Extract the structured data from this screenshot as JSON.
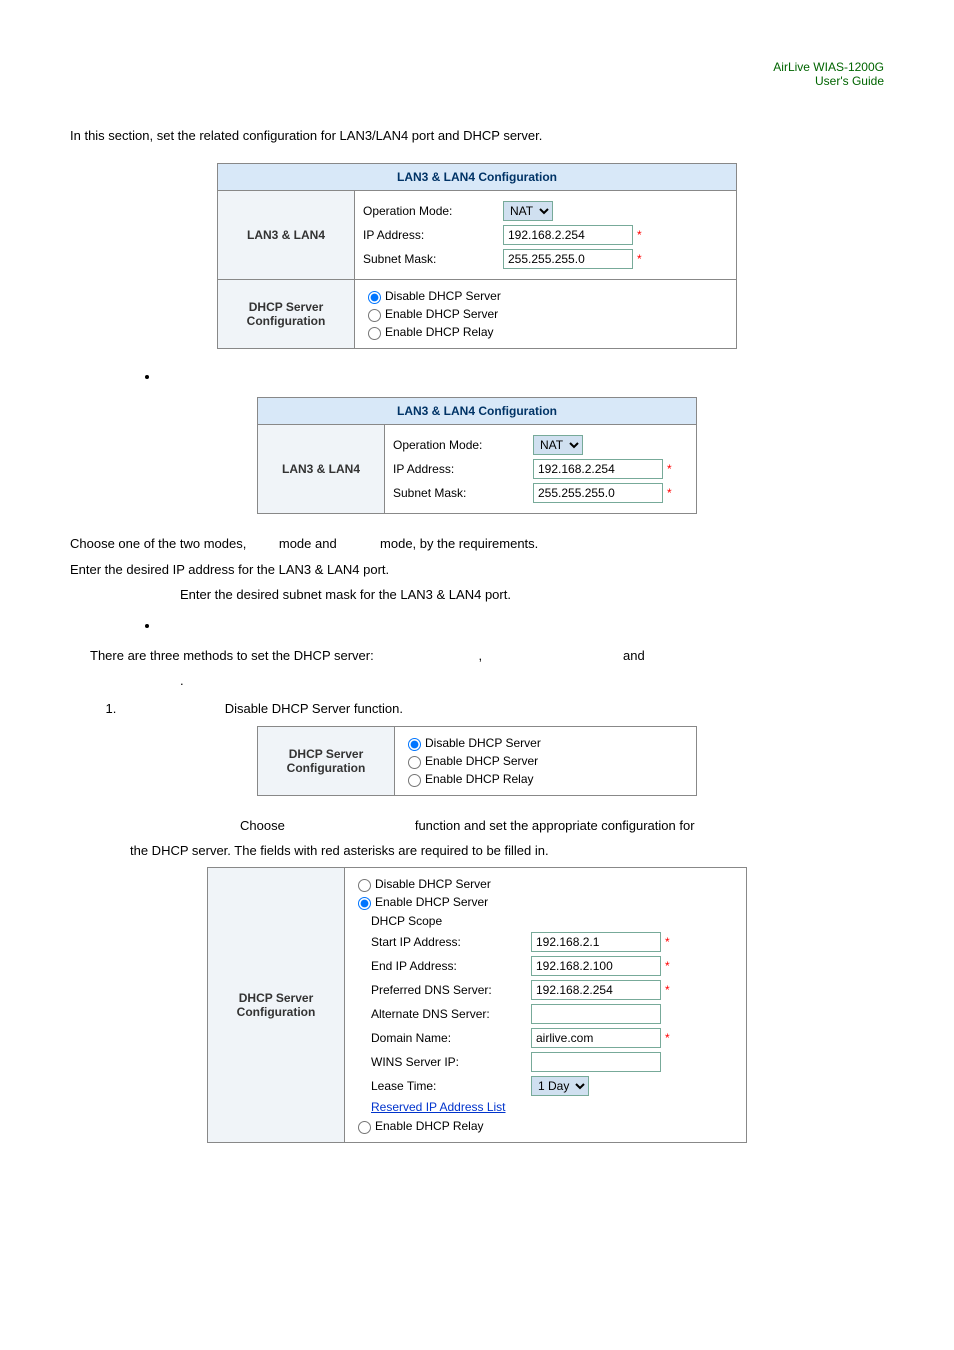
{
  "header": {
    "product": "AirLive  WIAS-1200G",
    "subtitle": "User's  Guide"
  },
  "intro": "In this section, set the related configuration for LAN3/LAN4 port and DHCP server.",
  "table1": {
    "title": "LAN3 & LAN4 Configuration",
    "row1_label": "LAN3 & LAN4",
    "op_mode_label": "Operation Mode:",
    "op_mode_value": "NAT",
    "ip_label": "IP Address:",
    "ip_value": "192.168.2.254",
    "subnet_label": "Subnet Mask:",
    "subnet_value": "255.255.255.0",
    "row2_label": "DHCP Server Configuration",
    "radio1": "Disable DHCP Server",
    "radio2": "Enable DHCP Server",
    "radio3": "Enable DHCP Relay"
  },
  "table2": {
    "title": "LAN3 & LAN4 Configuration",
    "row1_label": "LAN3 & LAN4",
    "op_mode_label": "Operation Mode:",
    "op_mode_value": "NAT",
    "ip_label": "IP Address:",
    "ip_value": "192.168.2.254",
    "subnet_label": "Subnet Mask:",
    "subnet_value": "255.255.255.0"
  },
  "explain": {
    "modes_pre": "Choose one of the two modes,",
    "modes_mid": "mode and",
    "modes_post": "mode, by the requirements.",
    "ip_desc": "Enter the desired IP address for the LAN3 & LAN4 port.",
    "subnet_desc": "Enter the desired subnet mask for the LAN3 & LAN4 port."
  },
  "dhcp_intro": {
    "line1a": "There are three methods to set the DHCP server:",
    "line1b": ",",
    "line1c": "and",
    "line1d": "."
  },
  "item1": {
    "text": "Disable DHCP Server function."
  },
  "table3": {
    "row_label": "DHCP Server Configuration",
    "radio1": "Disable DHCP Server",
    "radio2": "Enable DHCP Server",
    "radio3": "Enable DHCP Relay"
  },
  "item2": {
    "pre": "Choose",
    "post": "function and set the appropriate configuration for",
    "line2": "the DHCP server. The fields with red asterisks are required to be filled in."
  },
  "table4": {
    "row_label": "DHCP Server Configuration",
    "radio1": "Disable DHCP Server",
    "radio2": "Enable DHCP Server",
    "scope": "DHCP Scope",
    "start_label": "Start IP Address:",
    "start_value": "192.168.2.1",
    "end_label": "End IP Address:",
    "end_value": "192.168.2.100",
    "pref_dns_label": "Preferred DNS Server:",
    "pref_dns_value": "192.168.2.254",
    "alt_dns_label": "Alternate DNS Server:",
    "alt_dns_value": "",
    "domain_label": "Domain Name:",
    "domain_value": "airlive.com",
    "wins_label": "WINS Server IP:",
    "wins_value": "",
    "lease_label": "Lease Time:",
    "lease_value": "1 Day",
    "reserved_link": "Reserved IP Address List",
    "radio3": "Enable DHCP Relay"
  }
}
